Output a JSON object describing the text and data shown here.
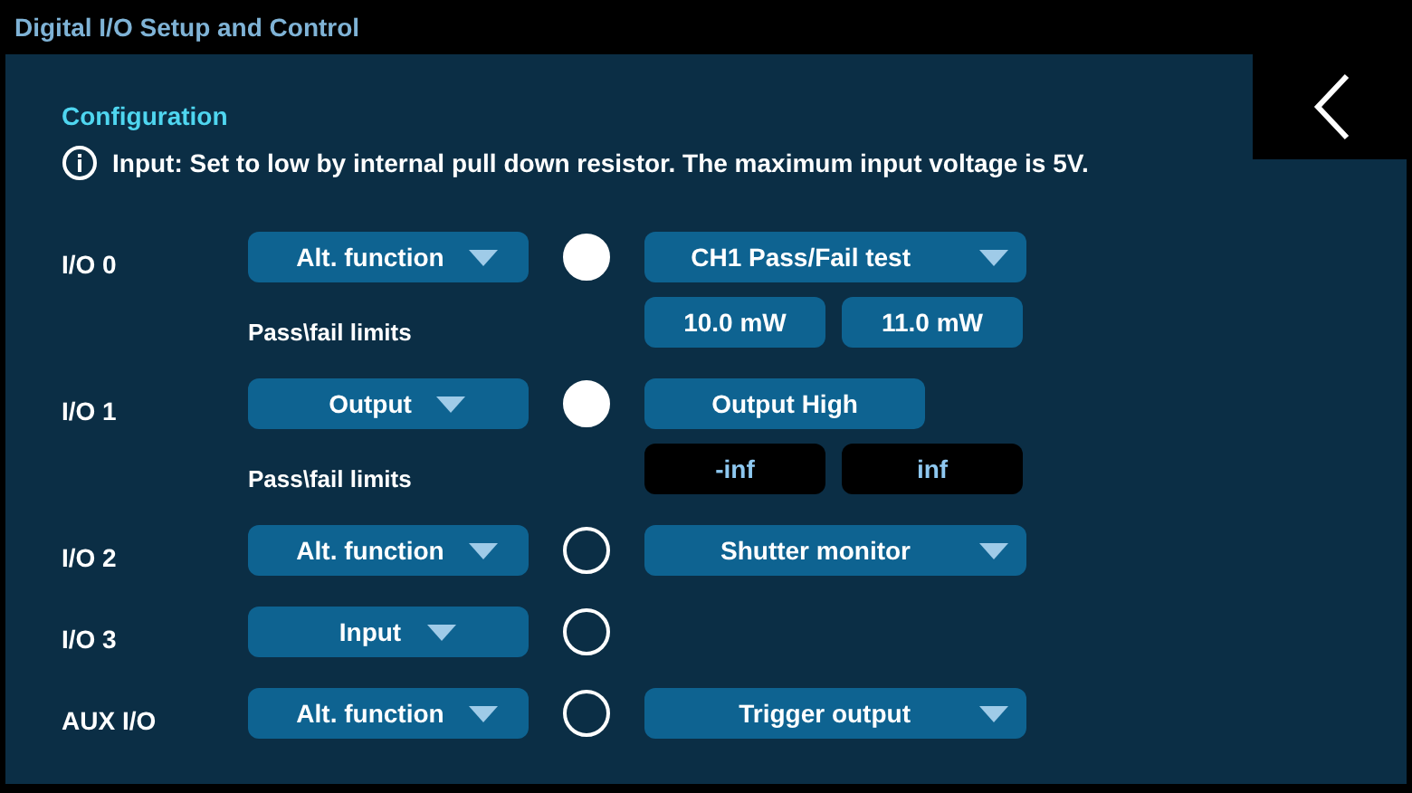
{
  "window": {
    "title": "Digital I/O Setup and Control"
  },
  "section": {
    "title": "Configuration",
    "info": "Input: Set to low by internal pull down resistor. The maximum input voltage is 5V."
  },
  "channels": [
    {
      "label": "I/O 0",
      "mode": "Alt. function",
      "active": true,
      "function": {
        "kind": "dropdown",
        "text": "CH1 Pass/Fail test"
      },
      "limits": {
        "label": "Pass\\fail limits",
        "values": [
          {
            "text": "10.0 mW",
            "disabled": false
          },
          {
            "text": "11.0 mW",
            "disabled": false
          }
        ]
      }
    },
    {
      "label": "I/O 1",
      "mode": "Output",
      "active": true,
      "function": {
        "kind": "button",
        "text": "Output High"
      },
      "limits": {
        "label": "Pass\\fail limits",
        "values": [
          {
            "text": "-inf",
            "disabled": true
          },
          {
            "text": "inf",
            "disabled": true
          }
        ]
      }
    },
    {
      "label": "I/O 2",
      "mode": "Alt. function",
      "active": false,
      "function": {
        "kind": "dropdown",
        "text": "Shutter monitor"
      }
    },
    {
      "label": "I/O 3",
      "mode": "Input",
      "active": false
    },
    {
      "label": "AUX I/O",
      "mode": "Alt. function",
      "active": false,
      "function": {
        "kind": "dropdown",
        "text": "Trigger output"
      }
    }
  ]
}
